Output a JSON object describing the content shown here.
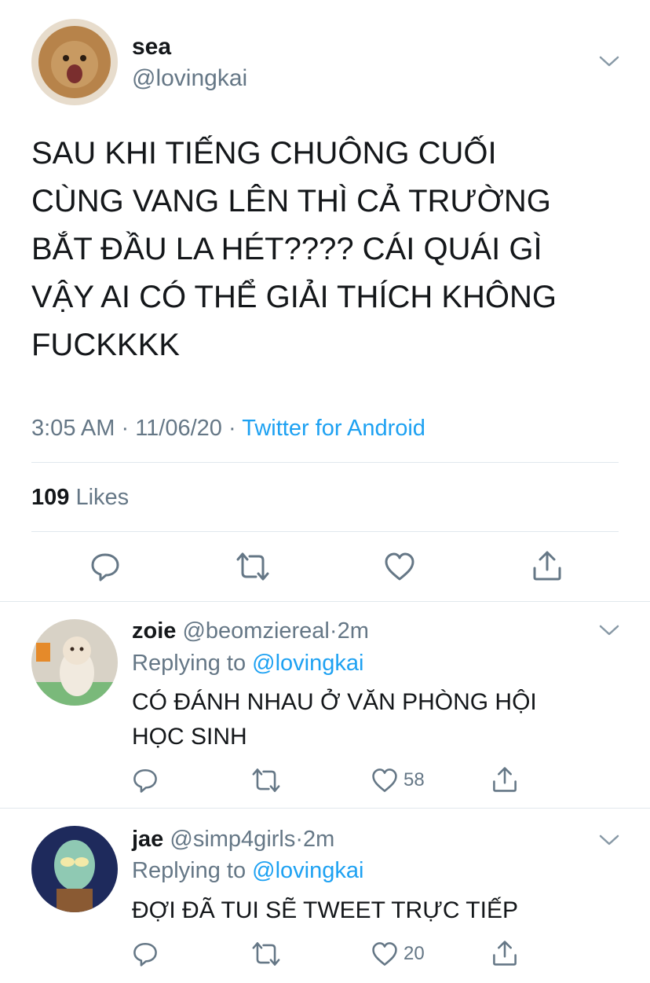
{
  "main_tweet": {
    "author_name": "sea",
    "author_handle": "@lovingkai",
    "text_lines": [
      "SAU KHI TIẾNG CHUÔNG CUỐI",
      "CÙNG VANG LÊN THÌ CẢ TRƯỜNG",
      "BẮT ĐẦU LA HÉT???? CÁI QUÁI GÌ",
      "VẬY AI CÓ THỂ GIẢI THÍCH KHÔNG",
      "FUCKKKK"
    ],
    "time": "3:05 AM",
    "date": "11/06/20",
    "separator": "·",
    "source": "Twitter for Android",
    "likes_count": "109",
    "likes_label": "Likes"
  },
  "replies": [
    {
      "name": "zoie",
      "handle": "@beomziereal",
      "dot": "·",
      "time": "2m",
      "replying_label": "Replying to",
      "replying_handle": "@lovingkai",
      "text_lines": [
        "CÓ ĐÁNH NHAU Ở VĂN PHÒNG HỘI",
        "HỌC SINH"
      ],
      "like_count": "58"
    },
    {
      "name": "jae",
      "handle": "@simp4girls",
      "dot": "·",
      "time": "2m",
      "replying_label": "Replying to",
      "replying_handle": "@lovingkai",
      "text_lines": [
        "ĐỢI ĐÃ TUI SẼ TWEET TRỰC TIẾP"
      ],
      "like_count": "20"
    }
  ],
  "icons": [
    "chevron-down-icon",
    "reply-icon",
    "retweet-icon",
    "like-icon",
    "share-icon"
  ],
  "colors": {
    "link": "#1da1f2",
    "muted": "#657786",
    "divider": "#e1e8ed",
    "icon": "#657786"
  }
}
